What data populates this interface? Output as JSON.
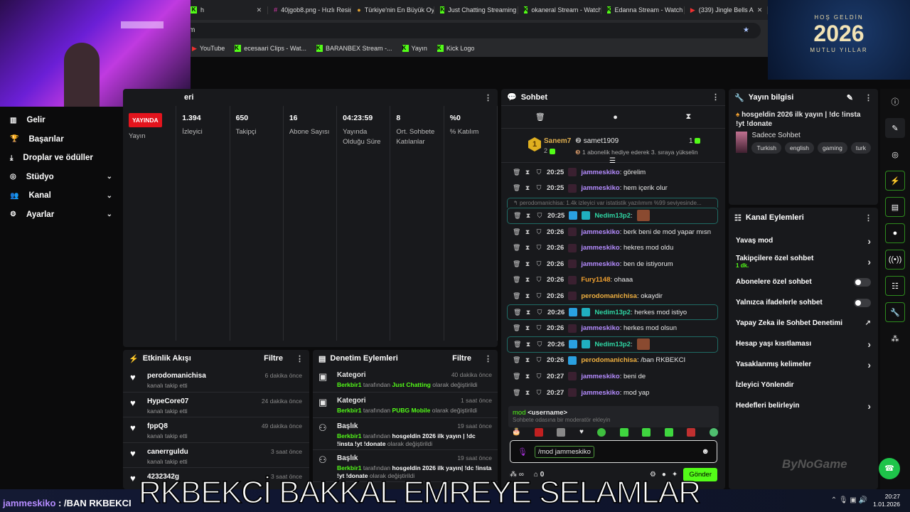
{
  "browser": {
    "tabs": [
      {
        "label": "h",
        "icon": "kick"
      },
      {
        "label": "40jgob8.png - Hızlı Resim",
        "icon": "image"
      },
      {
        "label": "Türkiye'nin En Büyük Oyun",
        "icon": "site"
      },
      {
        "label": "Just Chatting Streaming -",
        "icon": "kick"
      },
      {
        "label": "okaneral Stream - Watch",
        "icon": "kick"
      },
      {
        "label": "Edanna Stream - Watch L",
        "icon": "kick"
      },
      {
        "label": "(339) Jingle Bells A",
        "icon": "youtube"
      }
    ],
    "address": "m",
    "bookmarks": [
      "YouTube",
      "ecesaari Clips - Wat...",
      "BARANBEX Stream -...",
      "Yayın",
      "Kick Logo"
    ]
  },
  "banner": {
    "top": "HOŞ GELDİN",
    "year": "2026",
    "bottom": "MUTLU YILLAR"
  },
  "sidebar": {
    "items": [
      {
        "label": "Gelir",
        "icon": "chart"
      },
      {
        "label": "Başarılar",
        "icon": "trophy"
      },
      {
        "label": "Droplar ve ödüller",
        "icon": "drop"
      },
      {
        "label": "Stüdyo",
        "icon": "camera",
        "chevron": true
      },
      {
        "label": "Kanal",
        "icon": "users",
        "chevron": true
      },
      {
        "label": "Ayarlar",
        "icon": "gear",
        "chevron": true
      }
    ]
  },
  "stats": {
    "title": "eri",
    "live_badge": "YAYINDA",
    "columns": [
      {
        "value": "",
        "label": "Yayın"
      },
      {
        "value": "1.394",
        "label": "İzleyici"
      },
      {
        "value": "650",
        "label": "Takipçi"
      },
      {
        "value": "16",
        "label": "Abone Sayısı"
      },
      {
        "value": "04:23:59",
        "label": "Yayında Olduğu Süre"
      },
      {
        "value": "8",
        "label": "Ort. Sohbete Katılanlar"
      },
      {
        "value": "%0",
        "label": "% Katılım"
      }
    ]
  },
  "activity": {
    "title": "Etkinlik Akışı",
    "filter": "Filtre",
    "items": [
      {
        "name": "perodomanichisa",
        "sub": "kanalı takip etti",
        "time": "6 dakika önce"
      },
      {
        "name": "HypeCore07",
        "sub": "kanalı takip etti",
        "time": "24 dakika önce"
      },
      {
        "name": "fppQ8",
        "sub": "kanalı takip etti",
        "time": "49 dakika önce"
      },
      {
        "name": "canerrguldu",
        "sub": "kanalı takip etti",
        "time": "3 saat önce"
      },
      {
        "name": "4232342g",
        "sub": "",
        "time": "3 saat önce"
      }
    ]
  },
  "moderation": {
    "title": "Denetim Eylemleri",
    "filter": "Filtre",
    "items": [
      {
        "type": "Kategori",
        "user": "Berkbir1",
        "by": "tarafından",
        "value": "Just Chatting",
        "suffix": "olarak değiştirildi",
        "time": "40 dakika önce"
      },
      {
        "type": "Kategori",
        "user": "Berkbir1",
        "by": "tarafından",
        "value": "PUBG Mobile",
        "suffix": "olarak değiştirildi",
        "time": "1 saat önce"
      },
      {
        "type": "Başlık",
        "user": "Berkbir1",
        "by": "tarafından",
        "value": "hosgeldin 2026 ilk yayın | !dc !insta !yt !donate",
        "suffix": "olarak değiştirildi",
        "time": "19 saat önce"
      },
      {
        "type": "Başlık",
        "user": "Berkbir1",
        "by": "tarafından",
        "value": "hosgeldin 2026 ilk yayın| !dc !insta !yt !donate",
        "suffix": "olarak değiştirildi",
        "time": "19 saat önce"
      }
    ]
  },
  "chat": {
    "title": "Sohbet",
    "leaderboard": {
      "first": "Sanem7",
      "first_count": "2",
      "second": "samet1909",
      "second_count": "1",
      "third_hint": "1 abonelik hediye ederek 3. sıraya yükselin"
    },
    "reply_preview": "perodomanichisa: 1.4k izleyici var istatistik yazılımım %99 seviyesinde...",
    "messages": [
      {
        "time": "20:25",
        "user": "jammeskiko",
        "color": "#b58cff",
        "text": "görelim"
      },
      {
        "time": "20:25",
        "user": "jammeskiko",
        "color": "#b58cff",
        "text": "hem içerik olur"
      },
      {
        "time": "20:25",
        "user": "Nedim13p2",
        "color": "#2fd6a4",
        "text": "",
        "highlight": true,
        "emote": true
      },
      {
        "time": "20:26",
        "user": "jammeskiko",
        "color": "#b58cff",
        "text": "berk beni de mod yapar mısn"
      },
      {
        "time": "20:26",
        "user": "jammeskiko",
        "color": "#b58cff",
        "text": "hekres mod oldu"
      },
      {
        "time": "20:26",
        "user": "jammeskiko",
        "color": "#b58cff",
        "text": "ben de istiyorum"
      },
      {
        "time": "20:26",
        "user": "Fury1148",
        "color": "#f0a030",
        "text": "ohaaa"
      },
      {
        "time": "20:26",
        "user": "perodomanichisa",
        "color": "#f0b040",
        "text": "okaydir"
      },
      {
        "time": "20:26",
        "user": "Nedim13p2",
        "color": "#2fd6a4",
        "text": "herkes mod istiyo",
        "highlight": true
      },
      {
        "time": "20:26",
        "user": "jammeskiko",
        "color": "#b58cff",
        "text": "herkes mod olsun"
      },
      {
        "time": "20:26",
        "user": "Nedim13p2",
        "color": "#2fd6a4",
        "text": "",
        "highlight": true,
        "emote": true
      },
      {
        "time": "20:26",
        "user": "perodomanichisa",
        "color": "#f0b040",
        "text": "/ban RKBEKCI"
      },
      {
        "time": "20:27",
        "user": "jammeskiko",
        "color": "#b58cff",
        "text": "beni de"
      },
      {
        "time": "20:27",
        "user": "jammeskiko",
        "color": "#b58cff",
        "text": "mod yap"
      }
    ],
    "suggestion": {
      "command": "mod",
      "arg": "<username>",
      "desc": "Sohbete odasına bir moderatör ekleyin"
    },
    "input_value": "/mod jammeskiko",
    "points": "∞",
    "store_count": "0",
    "send": "Gönder"
  },
  "stream_info": {
    "title_label": "Yayın bilgisi",
    "stream_title": "hosgeldin 2026 ilk yayın | !dc !insta !yt !donate",
    "category": "Sadece Sohbet",
    "tags": [
      "Turkish",
      "english",
      "gaming",
      "turk"
    ]
  },
  "channel_actions": {
    "title": "Kanal Eylemleri",
    "items": [
      {
        "label": "Yavaş mod",
        "control": "chevron"
      },
      {
        "label": "Takipçilere özel sohbet",
        "sub": "1 dk.",
        "control": "chevron"
      },
      {
        "label": "Abonelere özel sohbet",
        "control": "toggle",
        "on": false
      },
      {
        "label": "Yalnızca ifadelerle sohbet",
        "control": "toggle",
        "on": false
      },
      {
        "label": "Yapay Zeka ile Sohbet Denetimi",
        "control": "external"
      },
      {
        "label": "Hesap yaşı kısıtlaması",
        "control": "chevron"
      },
      {
        "label": "Yasaklanmış kelimeler",
        "control": "chevron"
      },
      {
        "label": "İzleyici Yönlendir",
        "control": "none"
      },
      {
        "label": "Hedefleri belirleyin",
        "control": "chevron"
      }
    ]
  },
  "overlay": {
    "text": "RKBEKCİ BAKKAL EMREYE SELAMLAR",
    "chat_line_user": "jammeskiko",
    "chat_line_text": " : /BAN RKBEKCI",
    "logo": "ByNoGame"
  },
  "taskbar": {
    "time": "20:27",
    "date": "1.01.2026"
  },
  "colors": {
    "accent": "#53fc18",
    "live": "#e4141d",
    "panel": "#18191c"
  }
}
